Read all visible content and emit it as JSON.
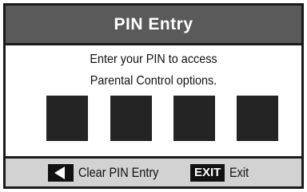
{
  "dialog": {
    "title": "PIN Entry",
    "prompt_line1": "Enter your PIN to access",
    "prompt_line2": "Parental Control options."
  },
  "pin": {
    "digit_count": 4,
    "entered_count": 0
  },
  "footer": {
    "clear_icon": "left-arrow-key-icon",
    "clear_label": "Clear PIN Entry",
    "exit_key": "EXIT",
    "exit_label": "Exit"
  },
  "colors": {
    "title_bar": "#5a5a5a",
    "digit_box": "#242424",
    "footer": "#d2d2d2",
    "border": "#1a1a1a"
  }
}
